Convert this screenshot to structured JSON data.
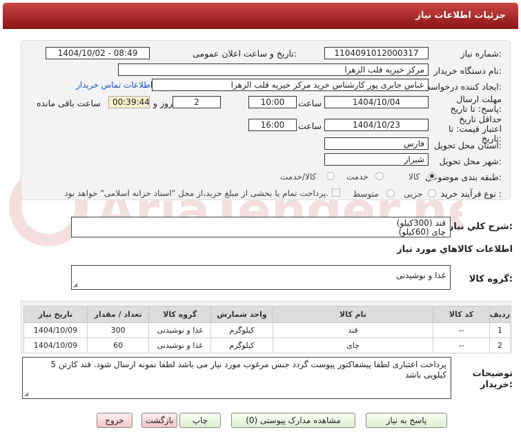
{
  "title": "جزئیات اطلاعات نیاز",
  "fields": {
    "need_number_label": "شماره نیاز:",
    "need_number": "1104091012000317",
    "announce_label": "تاریخ و ساعت اعلان عمومی:",
    "announce_value": "1404/10/02 - 08:49",
    "buyer_org_label": "نام دستگاه خریدار:",
    "buyer_org": "مرکز خیریه قلب الزهرا",
    "creator_label": "ایجاد کننده درخواست:",
    "creator": "عباس جابری پور کارشناس خرید مرکز خیریه قلب الزهرا",
    "contact_link": "اطلاعات تماس خریدار",
    "deadline_label": "مهلت ارسال پاسخ: تا تاریخ:",
    "deadline_date": "1404/10/04",
    "time_label": "ساعت",
    "deadline_time": "10:00",
    "days": "2",
    "days_label": "روز و",
    "remaining": "00:39:44",
    "remaining_label": "ساعت باقی مانده",
    "validity_label": "حداقل تاریخ اعتبار قیمت: تا تاریخ:",
    "validity_date": "1404/10/23",
    "validity_time": "16:00",
    "province_label": "استان محل تحویل:",
    "province": "فارس",
    "city_label": "شهر محل تحویل:",
    "city": "شیراز",
    "category_label": "طبقه بندی موضوعی:",
    "category_options": [
      "کالا",
      "خدمت",
      "کالا/خدمت"
    ],
    "process_label": "نوع فرآیند خرید :",
    "process_options": [
      "جزیی",
      "متوسط"
    ],
    "process_note": "پرداخت تمام یا بخشی از مبلغ خرید،از محل \"اسناد خزانه اسلامی\" خواهد بود."
  },
  "summary": {
    "label": "شرح کلي نياز:",
    "line1": "قند (300کیلو)",
    "line2": "چای (60کیلو)"
  },
  "goods_info_label": "اطلاعات کالاهاي مورد نياز",
  "goods_group": {
    "label": "گروه کالا:",
    "value": "غذا و نوشیدنی"
  },
  "table": {
    "headers": [
      "ردیف",
      "کد کالا",
      "نام کالا",
      "واحد شمارش",
      "گروه کالا",
      "تعداد / مقدار",
      "تاریخ نیاز"
    ],
    "rows": [
      [
        "1",
        "--",
        "قند",
        "کیلوگرم",
        "غذا و نوشیدنی",
        "300",
        "1404/10/09"
      ],
      [
        "2",
        "--",
        "چای",
        "کیلوگرم",
        "غذا و نوشیدنی",
        "60",
        "1404/10/09"
      ]
    ]
  },
  "buyer_notes": {
    "label1": "توضیحات",
    "label2": "خریدار:",
    "text": "پرداخت اعتباری لطفا پیشفاکتور پیوست گردد جنس مرغوب مورد نیاز می باشد لطفا نمونه ارسال شود. قند کارتن 5 کیلویی باشد"
  },
  "buttons": {
    "reply": "پاسخ به نیاز",
    "docs": "مشاهده مدارک پیوستی (0)",
    "print": "چاپ",
    "back": "بازگشت",
    "exit": "خروج"
  },
  "watermark": "AriaTender.net",
  "colors": {
    "header": "#b22222",
    "accent": "#1a54c8",
    "timer_bg": "#f6f0c8"
  }
}
